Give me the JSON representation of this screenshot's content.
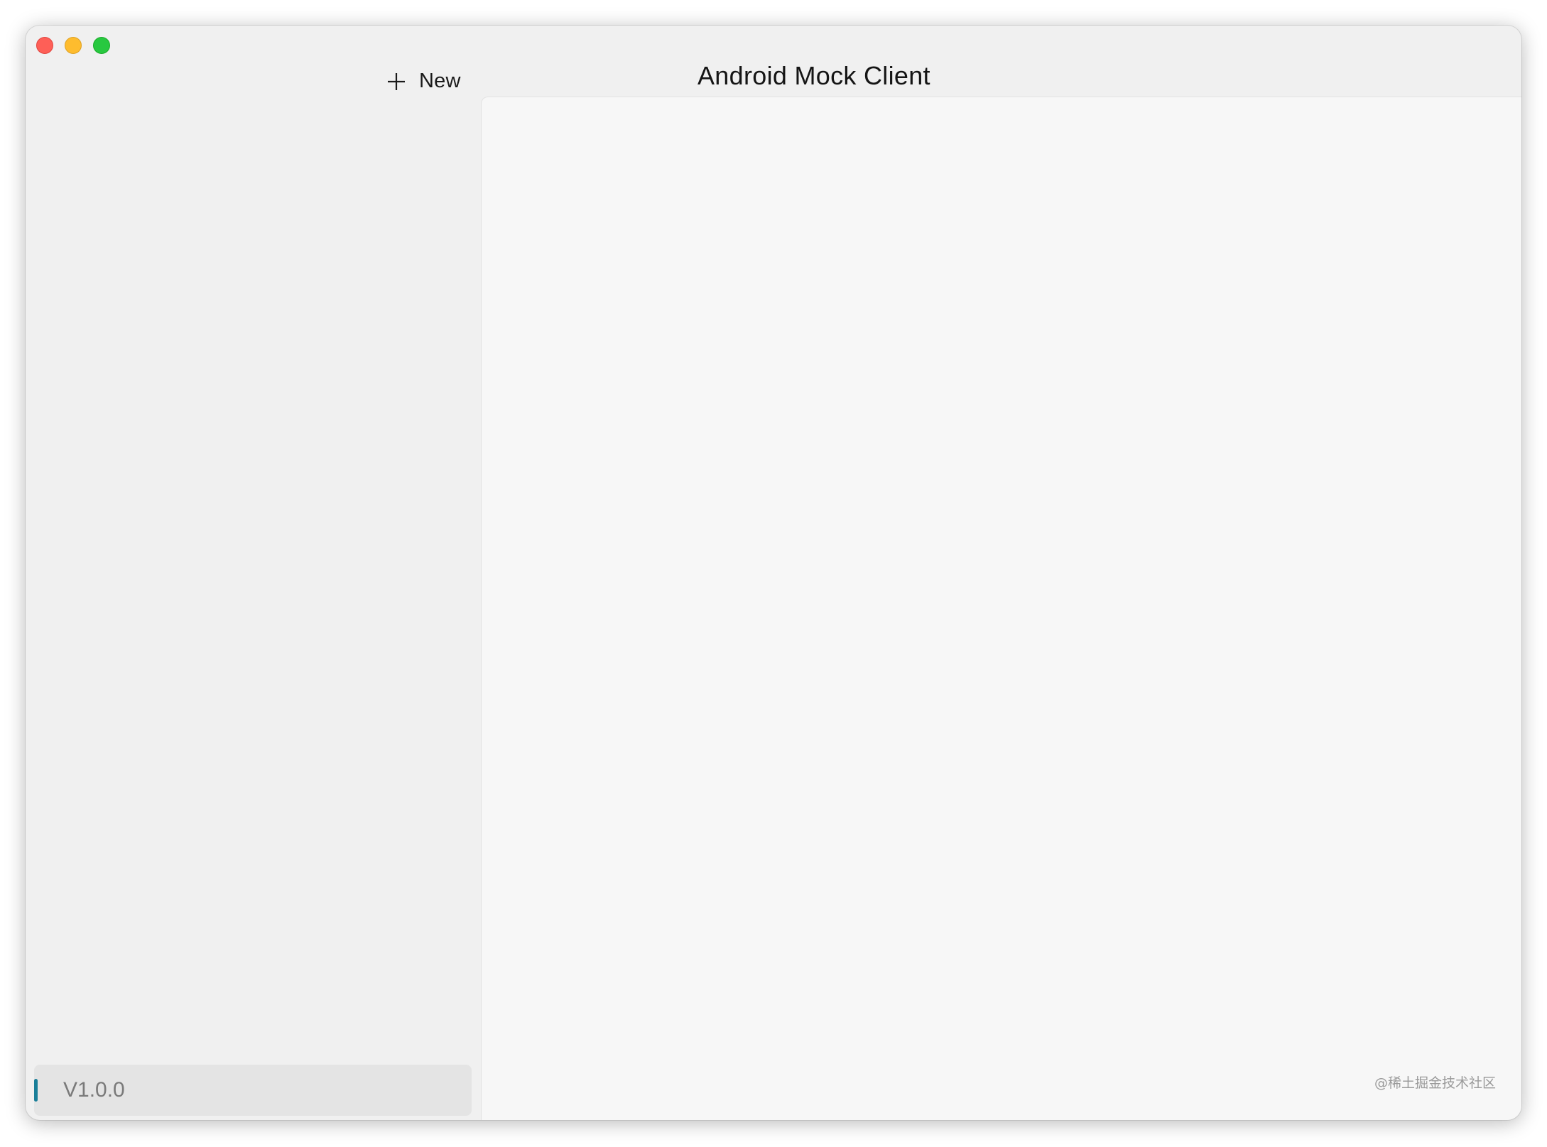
{
  "window": {
    "title": "Android Mock Client"
  },
  "toolbar": {
    "new_label": "New",
    "new_icon": "plus-icon"
  },
  "sidebar": {
    "items": [
      {
        "label": "V1.0.0",
        "selected": true
      }
    ]
  },
  "watermark": "@稀土掘金技术社区",
  "colors": {
    "accent": "#1a7f99",
    "close": "#fe5f57",
    "minimize": "#febc2e",
    "zoom": "#28c840"
  }
}
